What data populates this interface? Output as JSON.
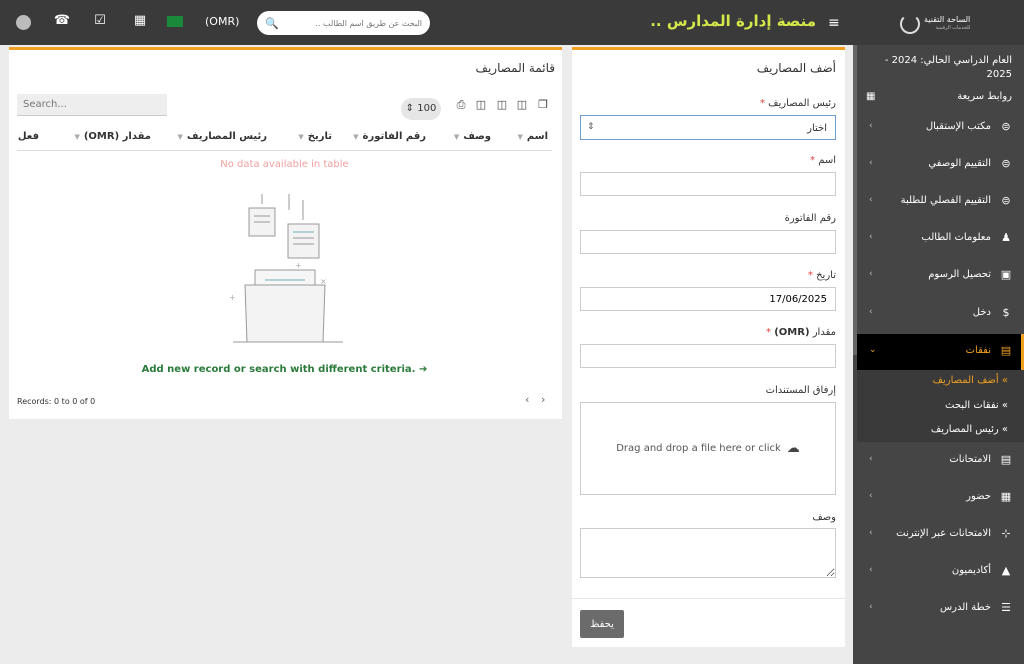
{
  "topbar": {
    "logo_line1": "الساحة التقنية",
    "logo_line2": "للخدمات الرقمية",
    "app_title": "منصة إدارة المدارس ..",
    "search_placeholder": "البحث عن طريق اسم الطالب ..",
    "currency": "(OMR)",
    "flag_text": "Oman"
  },
  "sidebar": {
    "academic_year": "العام الدراسي الحالي: 2024 - 2025",
    "quick_links": "روابط سريعة",
    "items": [
      {
        "label": "مكتب الإستقبال",
        "icon": "reception-icon"
      },
      {
        "label": "التقييم الوصفي",
        "icon": "assessment-icon"
      },
      {
        "label": "التقييم الفصلي للطلبة",
        "icon": "term-assessment-icon"
      },
      {
        "label": "معلومات الطالب",
        "icon": "user-plus-icon"
      },
      {
        "label": "تحصيل الرسوم",
        "icon": "money-icon"
      },
      {
        "label": "دخل",
        "icon": "dollar-icon"
      },
      {
        "label": "نفقات",
        "icon": "credit-card-icon"
      },
      {
        "label": "الامتحانات",
        "icon": "map-icon"
      },
      {
        "label": "حضور",
        "icon": "calendar-check-icon"
      },
      {
        "label": "الامتحانات عبر الإنترنت",
        "icon": "rss-icon"
      },
      {
        "label": "أكاديميون",
        "icon": "graduation-cap-icon"
      },
      {
        "label": "خطة الدرس",
        "icon": "list-icon"
      }
    ],
    "submenu": [
      "أضف المصاريف",
      "نفقات البحث",
      "رئيس المصاريف"
    ]
  },
  "form": {
    "title": "أضف المصاريف",
    "head_label": "رئيس المصاريف",
    "head_value": "اختار",
    "name_label": "اسم",
    "invoice_label": "رقم الفاتورة",
    "date_label": "تاريخ",
    "date_value": "17/06/2025",
    "amount_label": "مقدار",
    "amount_unit": "(OMR)",
    "attach_label": "إرفاق المستندات",
    "drop_text": "Drag and drop a file here or click",
    "desc_label": "وصف",
    "save": "يحفظ"
  },
  "list": {
    "title": "قائمة المصاريف",
    "search_placeholder": "Search...",
    "page_size": "100",
    "columns": [
      "اسم",
      "وصف",
      "رقم الفاتورة",
      "تاريخ",
      "رئيس المصاريف",
      "مقدار",
      "(OMR)",
      "فعل"
    ],
    "no_data": "No data available in table",
    "add_new": "Add new record or search with different criteria.",
    "records": "Records: 0 to 0 of 0"
  },
  "colors": {
    "accent": "#f0a020",
    "topbar": "#3a3a3a",
    "sidebar": "#454545",
    "title": "#d4e84a"
  }
}
